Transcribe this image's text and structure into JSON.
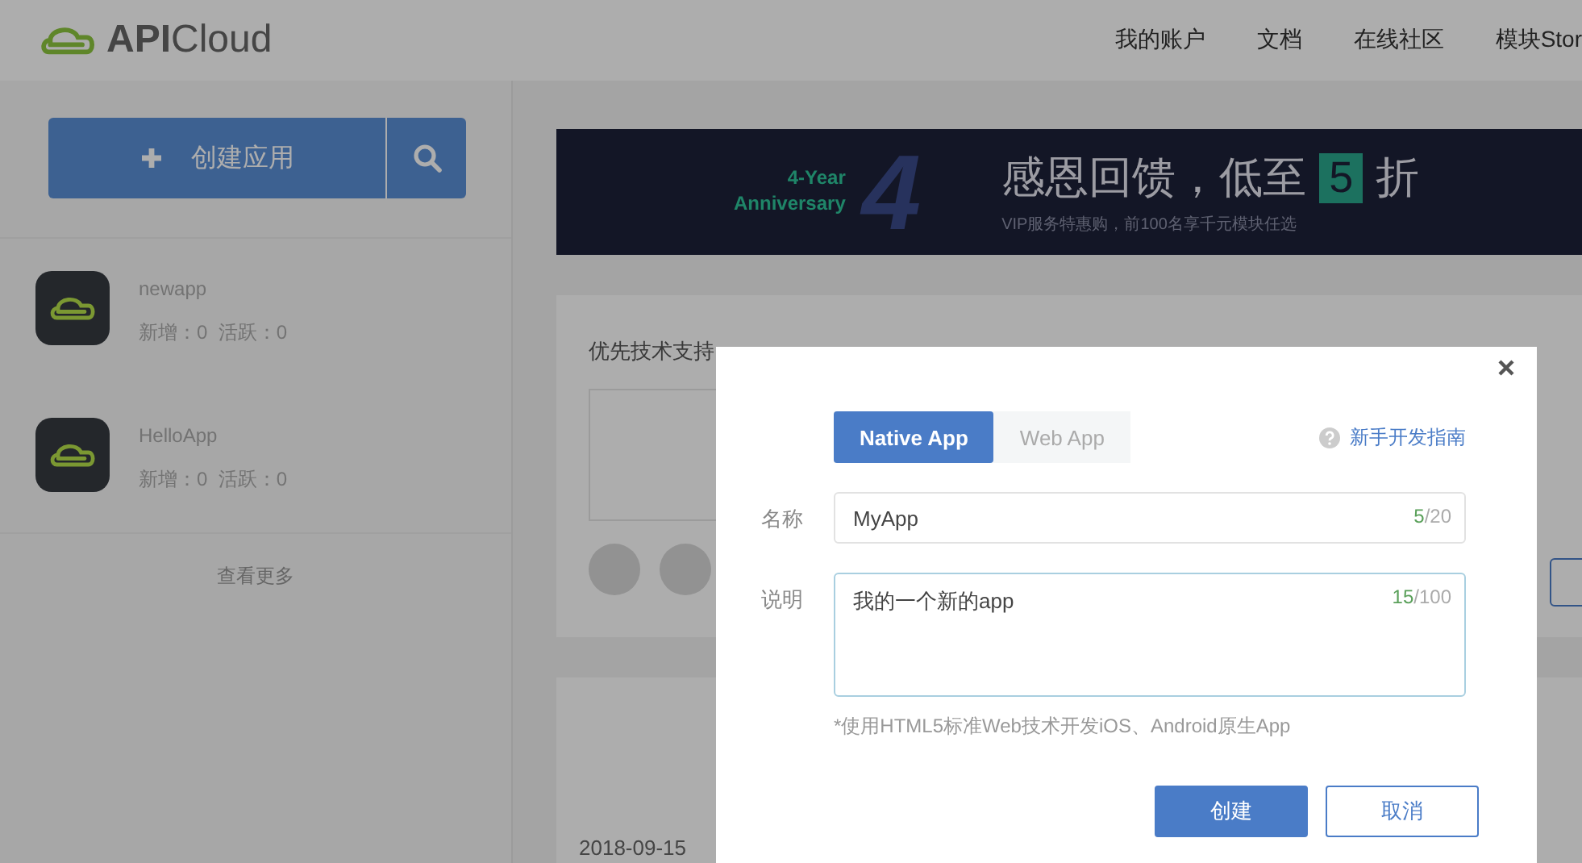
{
  "header": {
    "logo": "APICloud",
    "nav": [
      {
        "label": "我的账户"
      },
      {
        "label": "文档"
      },
      {
        "label": "在线社区"
      },
      {
        "label": "模块Stor"
      }
    ]
  },
  "sidebar": {
    "create_button": "创建应用",
    "apps": [
      {
        "name": "newapp",
        "stats": "新增：0  活跃：0"
      },
      {
        "name": "HelloApp",
        "stats": "新增：0  活跃：0"
      }
    ],
    "more_link": "查看更多"
  },
  "banner": {
    "badge_line1": "4-Year",
    "badge_line2": "Anniversary",
    "numeral": "4",
    "headline": "感恩回馈，低至",
    "discount": "5",
    "unit": "折",
    "subtitle": "VIP服务特惠购，前100名享千元模块任选"
  },
  "card": {
    "title": "优先技术支持"
  },
  "timeline": {
    "date": "2018-09-15"
  },
  "dialog": {
    "tabs": [
      {
        "label": "Native App",
        "selected": true
      },
      {
        "label": "Web App",
        "selected": false
      }
    ],
    "guide_link": "新手开发指南",
    "fields": [
      {
        "label": "名称",
        "kind": "input",
        "value": "MyApp",
        "count": "5",
        "limit": "/20"
      },
      {
        "label": "说明",
        "kind": "textarea",
        "value": "我的一个新的app",
        "count": "15",
        "limit": "/100"
      }
    ],
    "hint": "*使用HTML5标准Web技术开发iOS、Android原生App",
    "buttons": [
      {
        "label": "创建",
        "kind": "primary"
      },
      {
        "label": "取消",
        "kind": "secondary"
      }
    ]
  }
}
